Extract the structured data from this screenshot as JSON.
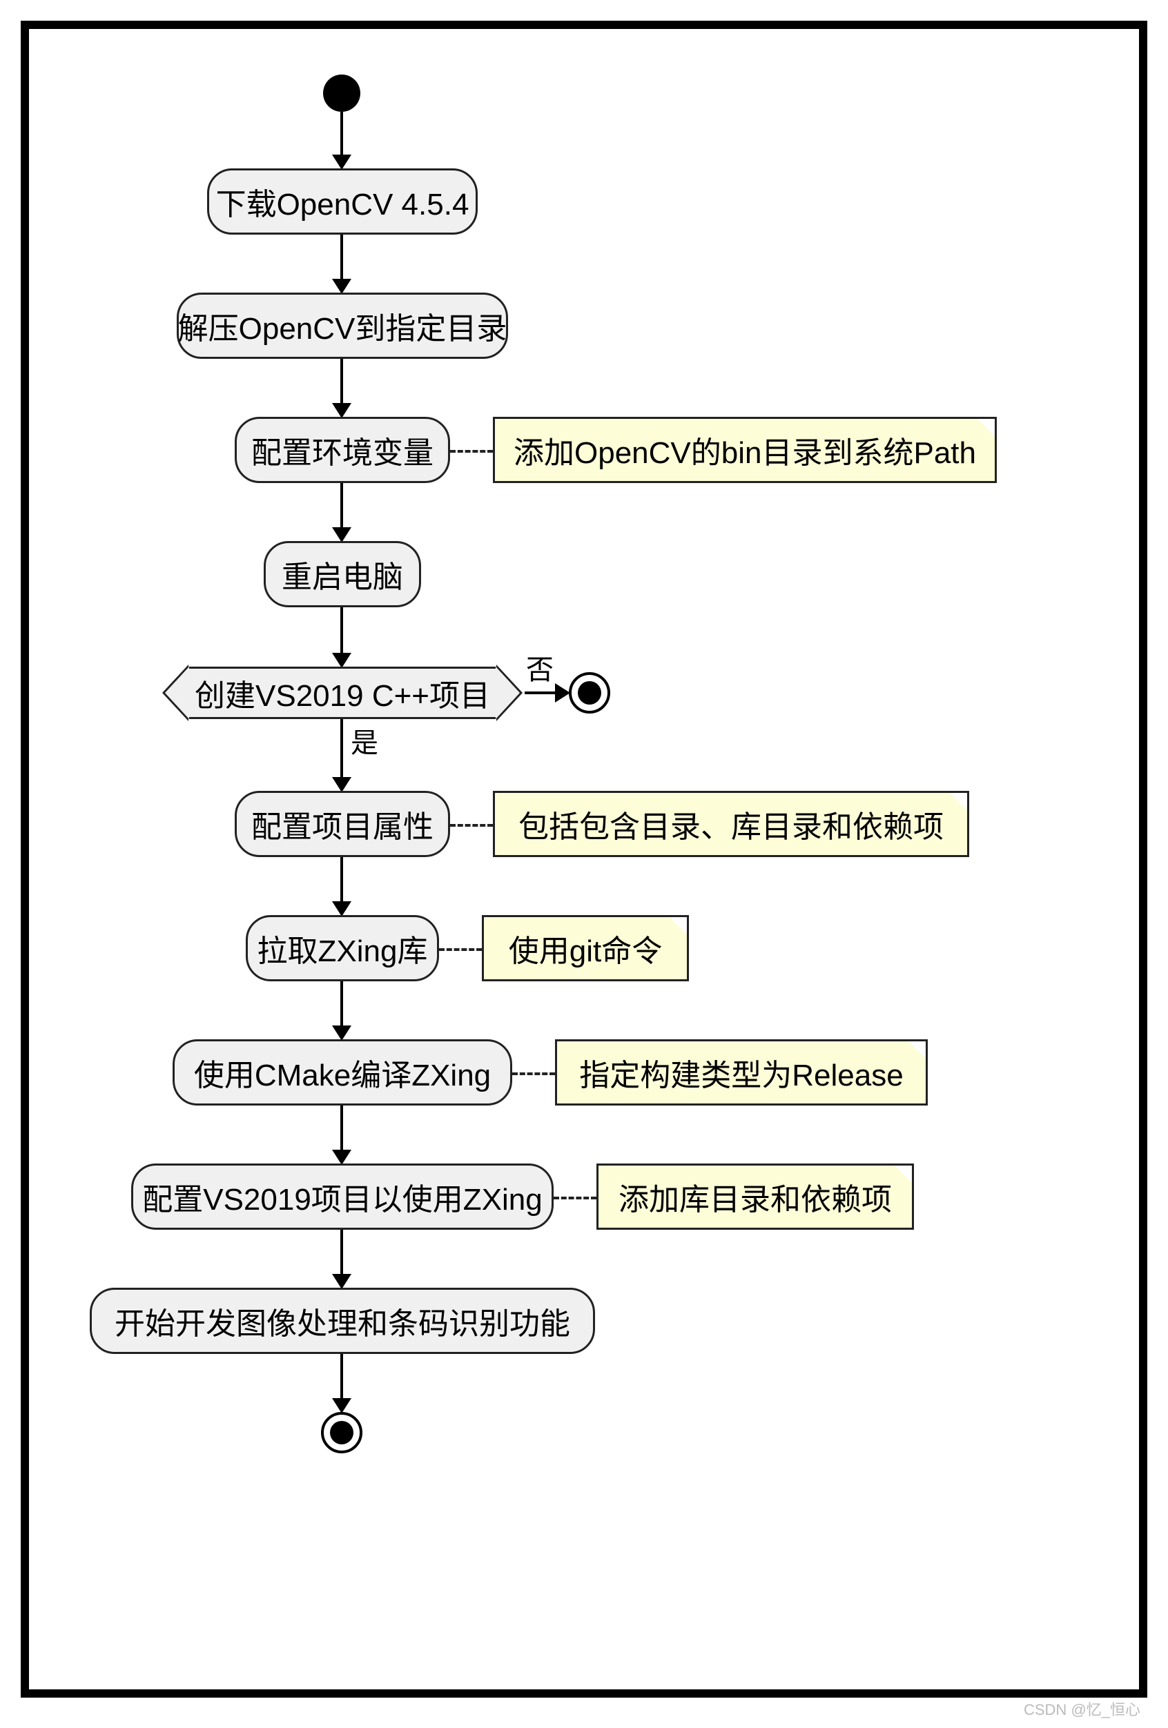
{
  "nodes": {
    "n1": "下载OpenCV 4.5.4",
    "n2": "解压OpenCV到指定目录",
    "n3": "配置环境变量",
    "n4": "重启电脑",
    "n5": "创建VS2019 C++项目",
    "n6": "配置项目属性",
    "n7": "拉取ZXing库",
    "n8": "使用CMake编译ZXing",
    "n9": "配置VS2019项目以使用ZXing",
    "n10": "开始开发图像处理和条码识别功能"
  },
  "notes": {
    "note3": "添加OpenCV的bin目录到系统Path",
    "note6": "包括包含目录、库目录和依赖项",
    "note7": "使用git命令",
    "note8": "指定构建类型为Release",
    "note9": "添加库目录和依赖项"
  },
  "labels": {
    "no": "否",
    "yes": "是"
  },
  "watermark": "CSDN @忆_恒心"
}
